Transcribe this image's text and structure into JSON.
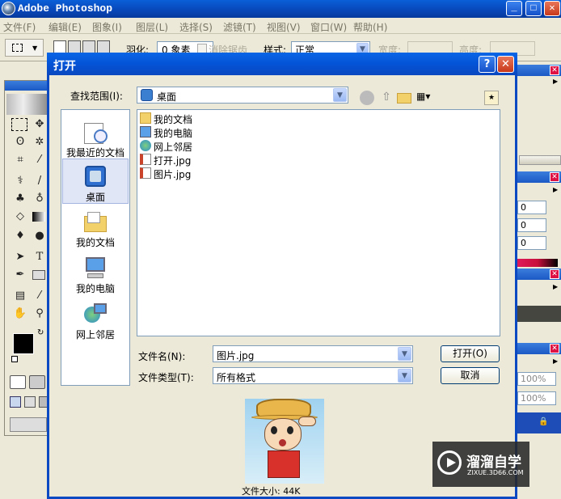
{
  "app": {
    "title": "Adobe Photoshop"
  },
  "menu": [
    "文件(F)",
    "编辑(E)",
    "图象(I)",
    "图层(L)",
    "选择(S)",
    "滤镜(T)",
    "视图(V)",
    "窗口(W)",
    "帮助(H)"
  ],
  "options": {
    "feather_label": "羽化:",
    "feather_value": "0 象素",
    "antialias_label": "消除锯齿",
    "style_label": "样式:",
    "style_value": "正常",
    "width_label": "宽度:",
    "height_label": "高度:"
  },
  "dialog": {
    "title": "打开",
    "help_glyph": "?",
    "close_glyph": "✕",
    "lookin_label": "查找范围(I):",
    "lookin_value": "桌面",
    "places": [
      "我最近的文档",
      "桌面",
      "我的文档",
      "我的电脑",
      "网上邻居"
    ],
    "files": [
      {
        "name": "我的文档",
        "icon": "folder-icon"
      },
      {
        "name": "我的电脑",
        "icon": "computer-icon"
      },
      {
        "name": "网上邻居",
        "icon": "network-icon"
      },
      {
        "name": "打开.jpg",
        "icon": "image-file-icon"
      },
      {
        "name": "图片.jpg",
        "icon": "image-file-icon"
      }
    ],
    "filename_label": "文件名(N):",
    "filename_value": "图片.jpg",
    "filetype_label": "文件类型(T):",
    "filetype_value": "所有格式",
    "open_button": "打开(O)",
    "cancel_button": "取消",
    "filesize_text": "文件大小: 44K"
  },
  "panels": {
    "inputs": [
      "0",
      "0",
      "0"
    ],
    "zoom": [
      "100%",
      "100%"
    ]
  },
  "watermark": {
    "main": "溜溜自学",
    "sub": "ZIXUE.3D66.COM"
  },
  "colors": {
    "title_blue": "#0453d6",
    "close_red": "#e04a2a",
    "panel_bg": "#ece9d8"
  }
}
